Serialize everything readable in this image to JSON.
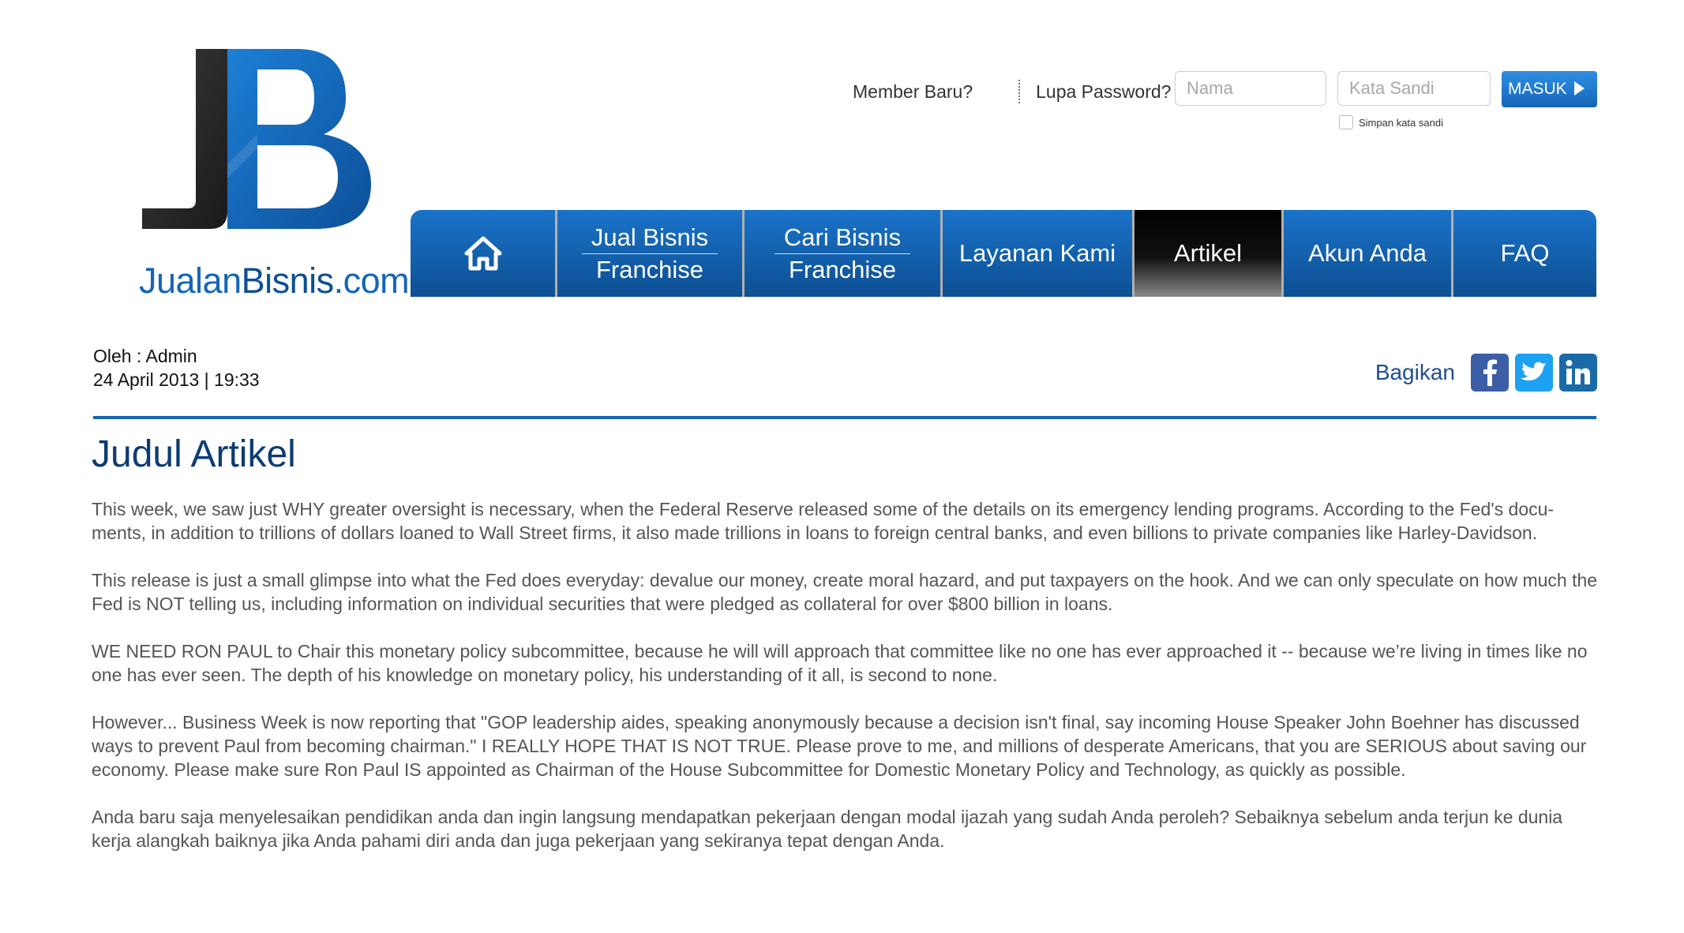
{
  "logo": {
    "mark": "JB",
    "name_part1": "Jualan",
    "name_part2": "Bisnis",
    "name_part3": ".com"
  },
  "header": {
    "member_baru": "Member Baru?",
    "lupa_password": "Lupa Password?",
    "username_placeholder": "Nama",
    "password_placeholder": "Kata Sandi",
    "login_button": "MASUK",
    "remember_label": "Simpan kata sandi"
  },
  "nav": {
    "items": [
      {
        "icon": "home-icon"
      },
      {
        "line1": "Jual Bisnis",
        "line2": "Franchise"
      },
      {
        "line1": "Cari Bisnis",
        "line2": "Franchise"
      },
      {
        "label": "Layanan Kami"
      },
      {
        "label": "Artikel",
        "active": true
      },
      {
        "label": "Akun Anda"
      },
      {
        "label": "FAQ"
      }
    ]
  },
  "article": {
    "author": "Oleh : Admin",
    "date": "24 April 2013 | 19:33",
    "share_label": "Bagikan",
    "share_icons": [
      "facebook-icon",
      "twitter-icon",
      "linkedin-icon"
    ],
    "title": "Judul Artikel",
    "paragraphs": [
      "This week, we saw just WHY greater oversight is necessary, when the Federal Reserve released some of the details on its emergency lending programs. According to the Fed's docu-ments, in addition to trillions of dollars loaned to Wall Street firms, it also made trillions in loans to foreign central banks, and even billions to private companies like Harley-Davidson.",
      "This release is just a small glimpse into what the Fed does everyday: devalue our money, create moral hazard, and put taxpayers on the hook. And we can only speculate on how much the Fed is NOT telling us, including information on individual securities that were pledged as collateral for over $800 billion in loans.",
      "WE NEED RON PAUL to Chair this monetary policy subcommittee, because he will will approach that committee like no one has ever approached it -- because we’re living in times like no one has ever seen. The depth of his knowledge on monetary policy, his understanding of it all, is second to none.",
      "However... Business Week is now reporting that \"GOP leadership aides, speaking anonymously because a decision isn't final, say incoming House Speaker John Boehner has discussed ways to prevent Paul from becoming chairman.\" I REALLY HOPE THAT IS NOT TRUE. Please prove to me, and millions of desperate Americans, that you are SERIOUS about saving our economy. Please make sure Ron Paul IS appointed as Chairman of the House Subcommittee for Domestic Monetary Policy and Technology, as quickly as possible.",
      "Anda baru saja menyelesaikan pendidikan anda dan ingin langsung mendapatkan pekerjaan dengan modal ijazah yang sudah Anda peroleh? Sebaiknya sebelum anda terjun ke dunia kerja alangkah baiknya jika Anda pahami diri anda dan juga pekerjaan yang sekiranya tepat dengan Anda."
    ]
  },
  "colors": {
    "brand_blue": "#1565b8",
    "nav_active": "#000000",
    "title": "#0d3b74",
    "body": "#555555"
  }
}
